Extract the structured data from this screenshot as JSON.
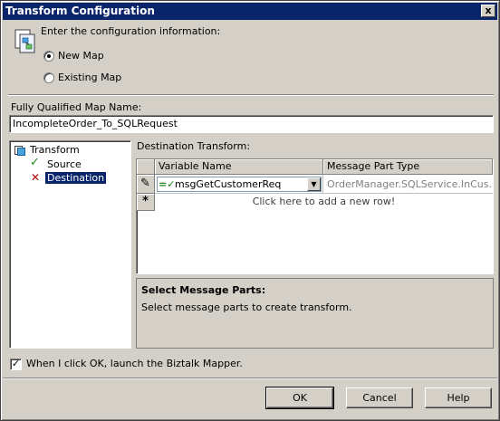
{
  "window": {
    "title": "Transform Configuration",
    "close_glyph": "x"
  },
  "intro": {
    "text": "Enter the configuration information:"
  },
  "map_choice": {
    "new_map_label": "New Map",
    "existing_map_label": "Existing Map",
    "selected": "New Map"
  },
  "map_name": {
    "label": "Fully Qualified Map Name:",
    "value": "IncompleteOrder_To_SQLRequest"
  },
  "tree": {
    "root": "Transform",
    "items": [
      {
        "label": "Source",
        "status": "valid",
        "status_glyph": "✓",
        "selected": false
      },
      {
        "label": "Destination",
        "status": "invalid",
        "status_glyph": "✕",
        "selected": true
      }
    ]
  },
  "destination": {
    "label": "Destination Transform:",
    "columns": [
      "Variable Name",
      "Message Part Type"
    ],
    "rows": [
      {
        "indicator": "✎",
        "variable": "msgGetCustomerReq",
        "type": "OrderManager.SQLService.InCus..."
      }
    ],
    "new_row_indicator": "*",
    "new_row_text": "Click here to add a new row!"
  },
  "info": {
    "title": "Select Message Parts:",
    "text": "Select message parts to create transform."
  },
  "launch_mapper": {
    "label": "When I click OK, launch the Biztalk Mapper.",
    "checked": true,
    "check_glyph": "✓"
  },
  "buttons": {
    "ok": "OK",
    "cancel": "Cancel",
    "help": "Help"
  },
  "colors": {
    "titlebar": "#0a246a",
    "selection": "#0a246a",
    "face": "#d4d0c8"
  }
}
